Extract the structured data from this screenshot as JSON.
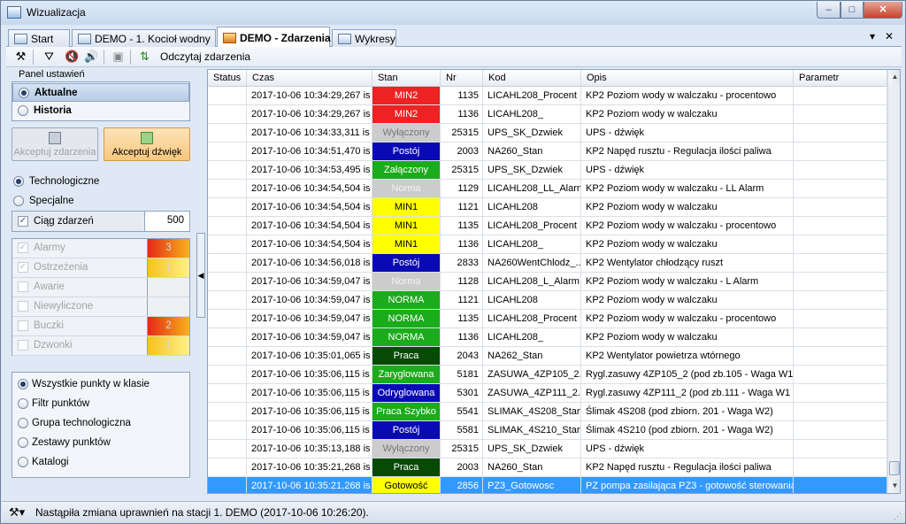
{
  "window": {
    "title": "Wizualizacja",
    "min": "–",
    "max": "□",
    "close": "✕"
  },
  "tabs": [
    {
      "label": "Start"
    },
    {
      "label": "DEMO - 1. Kocioł wodny"
    },
    {
      "label": "DEMO - Zdarzenia"
    },
    {
      "label": "Wykresy"
    }
  ],
  "tab_controls": {
    "dropdown": "▾",
    "close": "✕"
  },
  "toolbar": {
    "label": "Odczytaj zdarzenia"
  },
  "panel": {
    "title": "Panel ustawień",
    "mode": {
      "aktualne": "Aktualne",
      "historia": "Historia"
    },
    "accept_events": "Akceptuj zdarzenia",
    "accept_sound": "Akceptuj dźwięk",
    "source": {
      "tech": "Technologiczne",
      "special": "Specjalne"
    },
    "chain": {
      "label": "Ciąg zdarzeń",
      "value": "500"
    },
    "categories": [
      {
        "label": "Alarmy",
        "count": "3",
        "checked": true,
        "color": "linear-gradient(90deg,#e52a14,#f7b21c)"
      },
      {
        "label": "Ostrzeżenia",
        "count": "1",
        "checked": true,
        "color": "linear-gradient(90deg,#f7c21c,#fdf08a)"
      },
      {
        "label": "Awarie",
        "count": "",
        "checked": false,
        "color": "#eef0f3"
      },
      {
        "label": "Niewyliczone",
        "count": "",
        "checked": false,
        "color": "#eef0f3"
      },
      {
        "label": "Buczki",
        "count": "2",
        "checked": false,
        "color": "linear-gradient(90deg,#e52a14,#f7b21c)"
      },
      {
        "label": "Dzwonki",
        "count": "1",
        "checked": false,
        "color": "linear-gradient(90deg,#f7c21c,#fdf08a)"
      }
    ],
    "filters": [
      "Wszystkie punkty w klasie",
      "Filtr punktów",
      "Grupa technologiczna",
      "Zestawy punktów",
      "Katalogi"
    ]
  },
  "grid": {
    "columns": [
      "Status",
      "Czas",
      "Stan",
      "Nr",
      "Kod",
      "Opis",
      "Parametr"
    ],
    "rows": [
      {
        "czas": "2017-10-06 10:34:29,267 is",
        "stan": "MIN2",
        "bg": "#ee2222",
        "fg": "#ffffff",
        "nr": "1135",
        "kod": "LICAHL208_Procent",
        "opis": "KP2 Poziom wody w walczaku - procentowo"
      },
      {
        "czas": "2017-10-06 10:34:29,267 is",
        "stan": "MIN2",
        "bg": "#ee2222",
        "fg": "#ffffff",
        "nr": "1136",
        "kod": "LICAHL208_",
        "opis": "KP2 Poziom wody w walczaku"
      },
      {
        "czas": "2017-10-06 10:34:33,311 is",
        "stan": "Wyłączony",
        "bg": "#cccccc",
        "fg": "#777777",
        "nr": "25315",
        "kod": "UPS_SK_Dzwiek",
        "opis": "UPS - dźwięk"
      },
      {
        "czas": "2017-10-06 10:34:51,470 is",
        "stan": "Postój",
        "bg": "#0a0ab4",
        "fg": "#ffffff",
        "nr": "2003",
        "kod": "NA260_Stan",
        "opis": "KP2 Napęd rusztu - Regulacja ilości paliwa"
      },
      {
        "czas": "2017-10-06 10:34:53,495 is",
        "stan": "Załączony",
        "bg": "#1aac1a",
        "fg": "#ffffff",
        "nr": "25315",
        "kod": "UPS_SK_Dzwiek",
        "opis": "UPS - dźwięk"
      },
      {
        "czas": "2017-10-06 10:34:54,504 is",
        "stan": "Norma",
        "bg": "#cccccc",
        "fg": "#f2f2f2",
        "nr": "1129",
        "kod": "LICAHL208_LL_Alarm",
        "opis": "KP2 Poziom wody w walczaku - LL Alarm"
      },
      {
        "czas": "2017-10-06 10:34:54,504 is",
        "stan": "MIN1",
        "bg": "#ffff00",
        "fg": "#000000",
        "nr": "1121",
        "kod": "LICAHL208",
        "opis": "KP2 Poziom wody w walczaku"
      },
      {
        "czas": "2017-10-06 10:34:54,504 is",
        "stan": "MIN1",
        "bg": "#ffff00",
        "fg": "#000000",
        "nr": "1135",
        "kod": "LICAHL208_Procent",
        "opis": "KP2 Poziom wody w walczaku - procentowo"
      },
      {
        "czas": "2017-10-06 10:34:54,504 is",
        "stan": "MIN1",
        "bg": "#ffff00",
        "fg": "#000000",
        "nr": "1136",
        "kod": "LICAHL208_",
        "opis": "KP2 Poziom wody w walczaku"
      },
      {
        "czas": "2017-10-06 10:34:56,018 is",
        "stan": "Postój",
        "bg": "#0a0ab4",
        "fg": "#ffffff",
        "nr": "2833",
        "kod": "NA260WentChlodz_...",
        "opis": "KP2 Wentylator chłodzący ruszt"
      },
      {
        "czas": "2017-10-06 10:34:59,047 is",
        "stan": "Norma",
        "bg": "#cccccc",
        "fg": "#f2f2f2",
        "nr": "1128",
        "kod": "LICAHL208_L_Alarm",
        "opis": "KP2 Poziom wody w walczaku - L Alarm"
      },
      {
        "czas": "2017-10-06 10:34:59,047 is",
        "stan": "NORMA",
        "bg": "#1aac1a",
        "fg": "#ffffff",
        "nr": "1121",
        "kod": "LICAHL208",
        "opis": "KP2 Poziom wody w walczaku"
      },
      {
        "czas": "2017-10-06 10:34:59,047 is",
        "stan": "NORMA",
        "bg": "#1aac1a",
        "fg": "#ffffff",
        "nr": "1135",
        "kod": "LICAHL208_Procent",
        "opis": "KP2 Poziom wody w walczaku - procentowo"
      },
      {
        "czas": "2017-10-06 10:34:59,047 is",
        "stan": "NORMA",
        "bg": "#1aac1a",
        "fg": "#ffffff",
        "nr": "1136",
        "kod": "LICAHL208_",
        "opis": "KP2 Poziom wody w walczaku"
      },
      {
        "czas": "2017-10-06 10:35:01,065 is",
        "stan": "Praca",
        "bg": "#064a06",
        "fg": "#ffffff",
        "nr": "2043",
        "kod": "NA262_Stan",
        "opis": "KP2 Wentylator powietrza wtórnego"
      },
      {
        "czas": "2017-10-06 10:35:06,115 is",
        "stan": "Zaryglowana",
        "bg": "#1aac1a",
        "fg": "#ffffff",
        "nr": "5181",
        "kod": "ZASUWA_4ZP105_2...",
        "opis": "Rygl.zasuwy 4ZP105_2 (pod zb.105 - Waga W1 )"
      },
      {
        "czas": "2017-10-06 10:35:06,115 is",
        "stan": "Odryglowana",
        "bg": "#0a0ab4",
        "fg": "#ffffff",
        "nr": "5301",
        "kod": "ZASUWA_4ZP111_2...",
        "opis": "Rygl.zasuwy 4ZP111_2 (pod zb.111 - Waga W1 )"
      },
      {
        "czas": "2017-10-06 10:35:06,115 is",
        "stan": "Praca Szybko",
        "bg": "#1aac1a",
        "fg": "#ffffff",
        "nr": "5541",
        "kod": "SLIMAK_4S208_Stan",
        "opis": "Ślimak 4S208 (pod zbiorn. 201 - Waga W2)"
      },
      {
        "czas": "2017-10-06 10:35:06,115 is",
        "stan": "Postój",
        "bg": "#0a0ab4",
        "fg": "#ffffff",
        "nr": "5581",
        "kod": "SLIMAK_4S210_Stan",
        "opis": "Ślimak 4S210 (pod zbiorn. 201 - Waga W2)"
      },
      {
        "czas": "2017-10-06 10:35:13,188 is",
        "stan": "Wyłączony",
        "bg": "#cccccc",
        "fg": "#777777",
        "nr": "25315",
        "kod": "UPS_SK_Dzwiek",
        "opis": "UPS - dźwięk"
      },
      {
        "czas": "2017-10-06 10:35:21,268 is",
        "stan": "Praca",
        "bg": "#064a06",
        "fg": "#ffffff",
        "nr": "2003",
        "kod": "NA260_Stan",
        "opis": "KP2 Napęd rusztu - Regulacja ilości paliwa"
      },
      {
        "czas": "2017-10-06 10:35:21,268 is",
        "stan": "Gotowość",
        "bg": "#ffff00",
        "fg": "#000000",
        "nr": "2856",
        "kod": "PZ3_Gotowosc",
        "opis": "PZ pompa zasilająca PZ3 - gotowość sterowania ...",
        "selected": true
      }
    ]
  },
  "statusbar": {
    "text": "Nastąpiła zmiana uprawnień na stacji 1. DEMO (2017-10-06 10:26:20)."
  },
  "icons": [
    "app-icon",
    "tools-icon",
    "filter-icon",
    "mute-icon",
    "sound-icon",
    "accept-icon",
    "refresh-icon",
    "window-icon",
    "chart-icon"
  ]
}
